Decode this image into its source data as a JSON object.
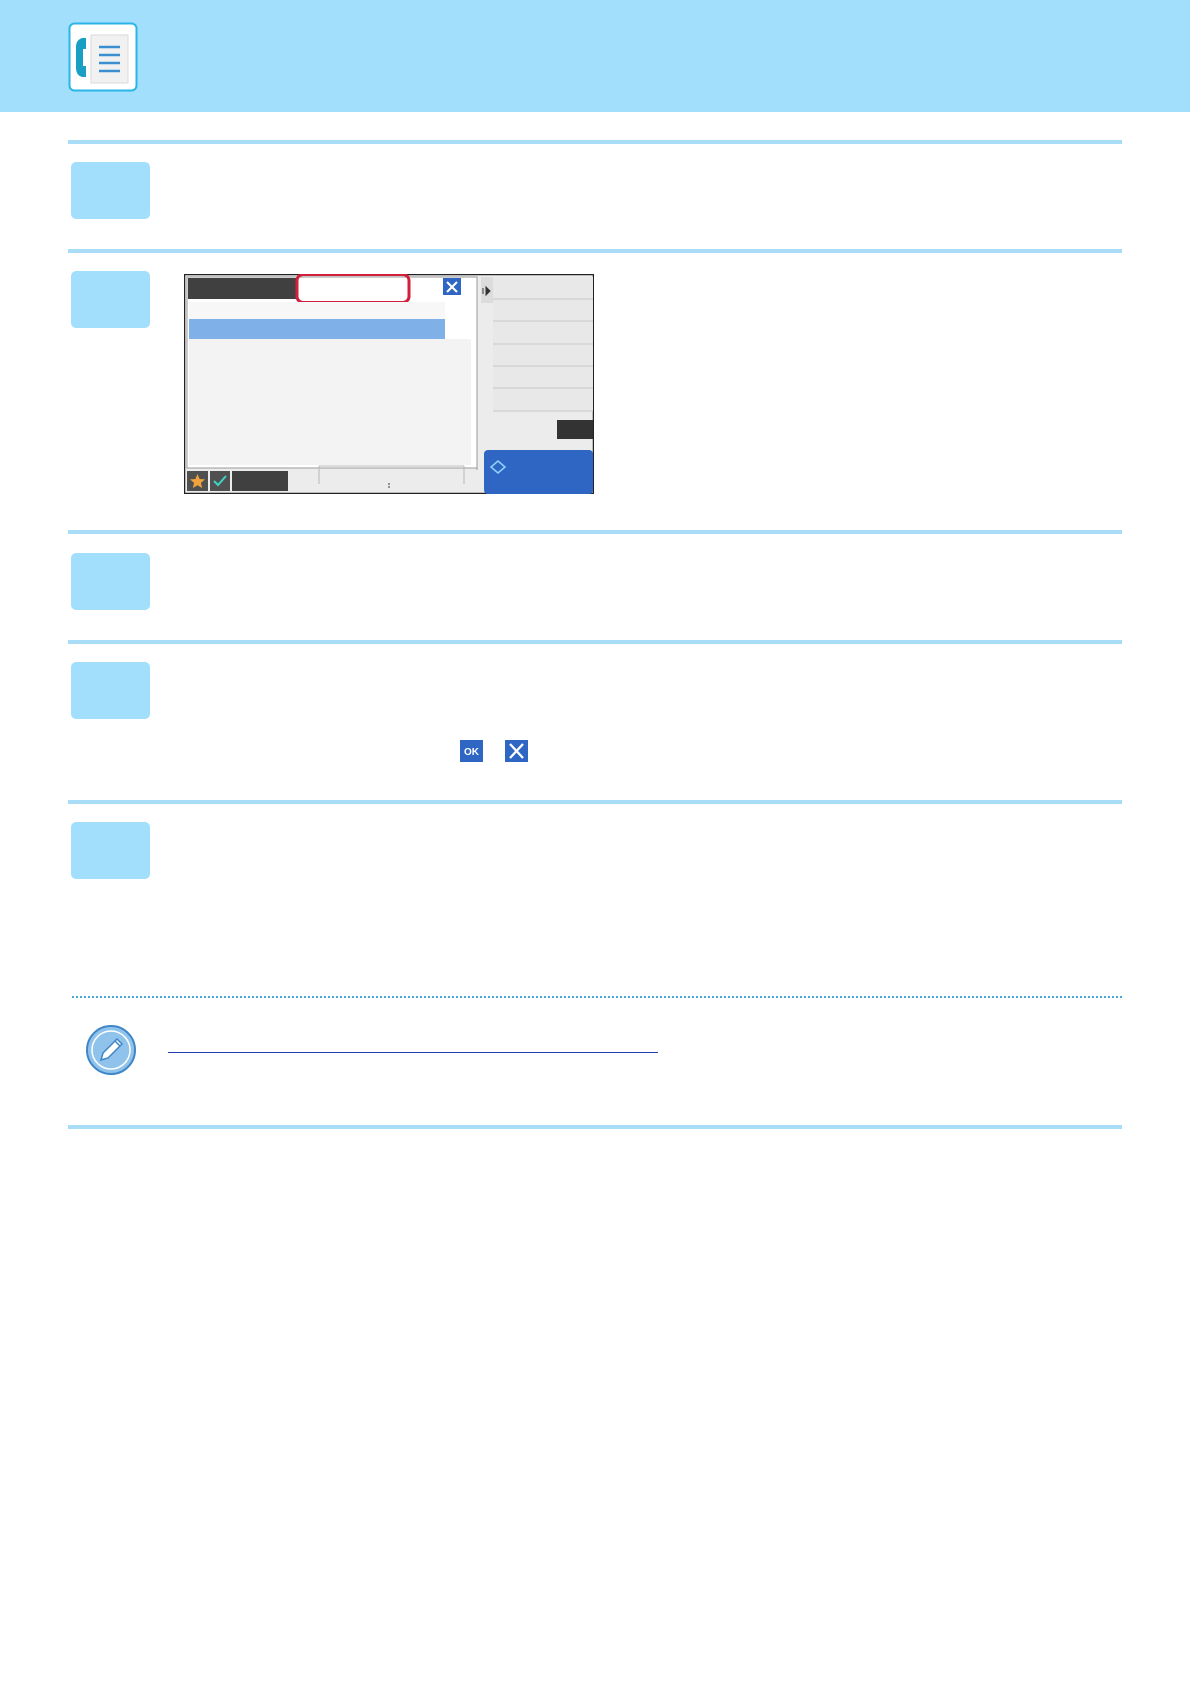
{
  "header": {
    "band_color": "#a2dffd",
    "icon": "fax-document-icon"
  },
  "colors": {
    "rule": "#a8dcf7",
    "step_box": "#a2dffd",
    "highlight": "#d21f3c",
    "link": "#1f3cab",
    "panel_button_blue": "#2f66c3",
    "panel_dark": "#404040"
  },
  "steps": [
    {
      "id": 1
    },
    {
      "id": 2,
      "has_screenshot": true
    },
    {
      "id": 3
    },
    {
      "id": 4,
      "inline_icons": [
        "ok-key-icon",
        "close-key-icon"
      ]
    },
    {
      "id": 5
    }
  ],
  "note": {
    "icon": "pencil-note-icon",
    "has_link": true
  },
  "screenshot": {
    "footer_icons": [
      "star-icon",
      "check-icon"
    ],
    "highlighted_tab": true,
    "close_button": "close-icon",
    "start_button": "start-diamond-icon"
  },
  "text": {
    "ok_label": "OK"
  }
}
